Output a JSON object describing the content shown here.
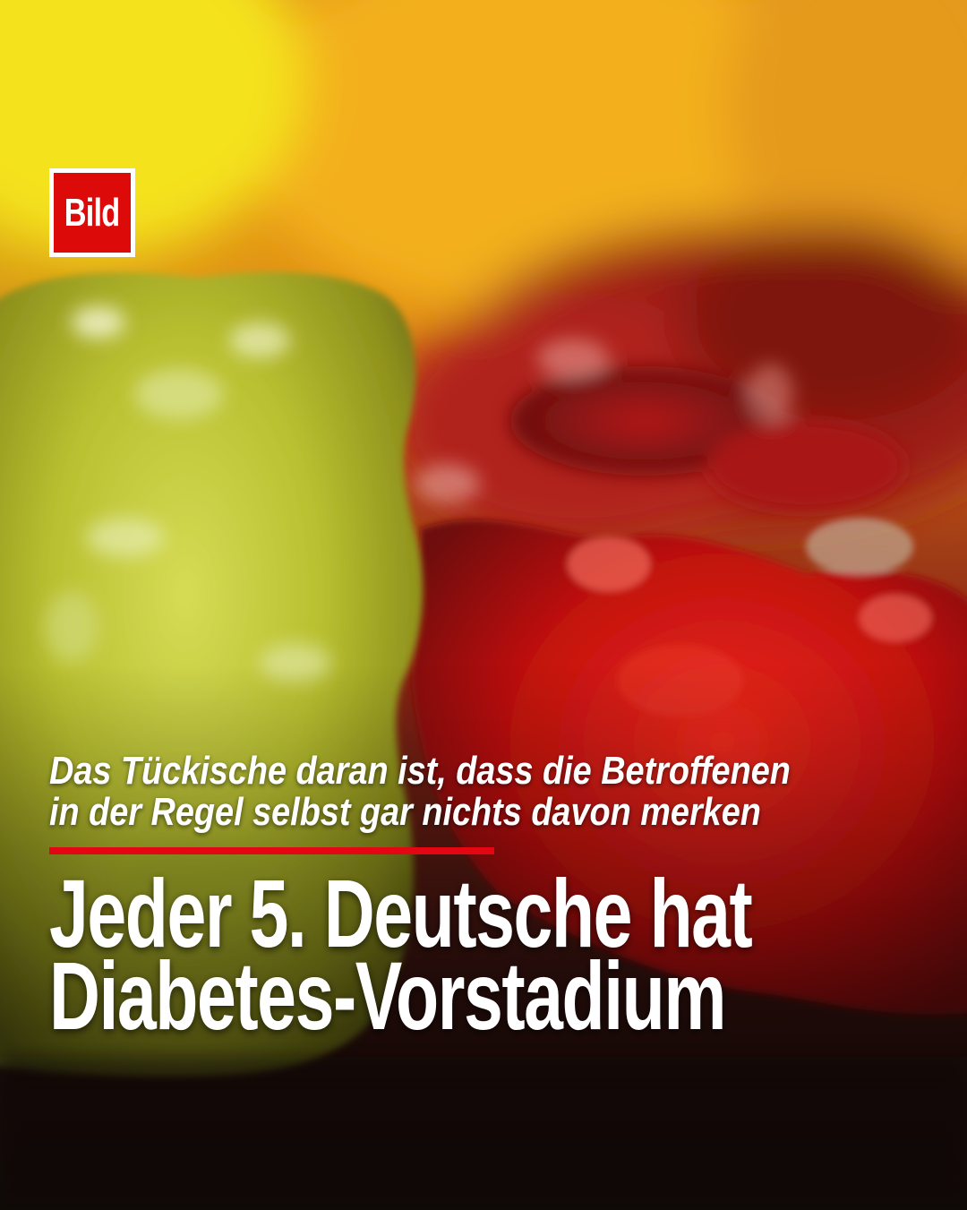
{
  "brand": {
    "logo_text": "Bild",
    "logo_color": "#dd0a0a"
  },
  "post": {
    "subline_lines": [
      "Das Tückische daran ist, dass die Betroffenen",
      "in der Regel selbst gar nichts davon merken"
    ],
    "rule_color": "#e30613",
    "headline_lines": [
      "Jeder 5. Deutsche hat",
      "Diabetes-Vorstadium"
    ]
  },
  "image": {
    "subject": "gummy-bears-photo",
    "colors": {
      "yellow_bear": "#c7d33a",
      "red_bear": "#d01414",
      "orange_bg": "#e8951c"
    }
  }
}
